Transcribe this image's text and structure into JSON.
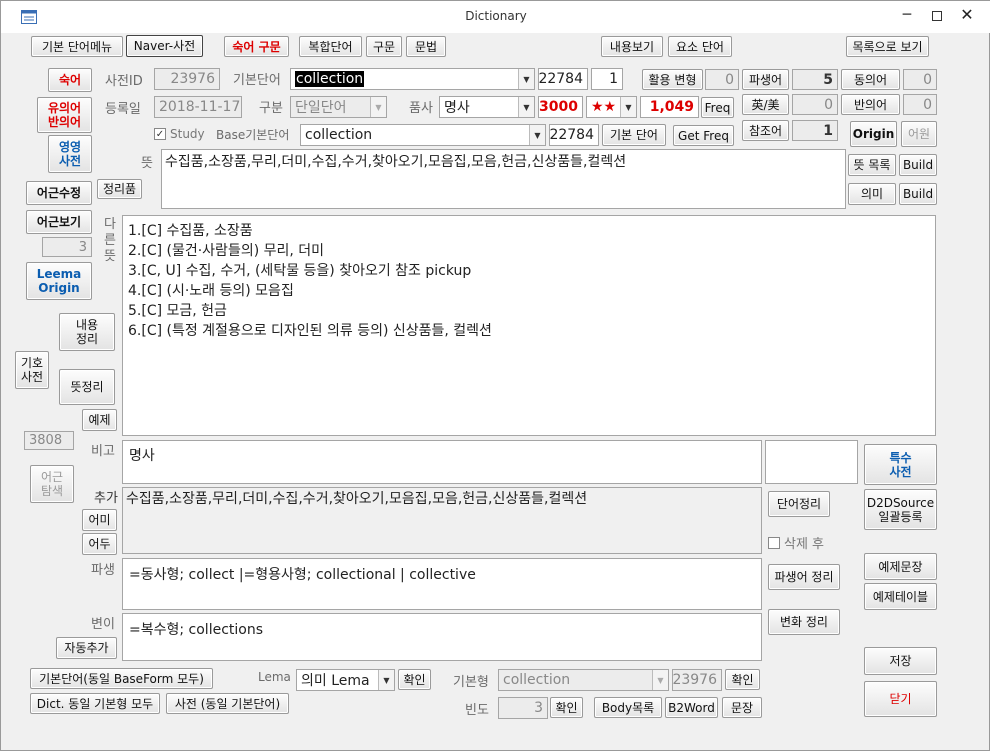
{
  "window": {
    "title": "Dictionary"
  },
  "toolbar": {
    "basic_menu": "기본 단어메뉴",
    "naver": "Naver-사전",
    "idiom": "숙어 구문",
    "compound": "복합단어",
    "phrase": "구문",
    "grammar": "문법",
    "view_content": "내용보기",
    "element_word": "요소 단어",
    "view_list": "목록으로 보기"
  },
  "left": {
    "idiom_btn": "숙어",
    "synonym_btn_1": "유의어",
    "synonym_btn_2": "반의어",
    "english_btn_1": "영영",
    "english_btn_2": "사전",
    "fix_root": "어근수정",
    "view_root": "어근보기",
    "root_count": "3",
    "leema_1": "Leema",
    "leema_2": "Origin",
    "content_1": "내용",
    "content_2": "정리",
    "symbol_1": "기호",
    "symbol_2": "사전",
    "meaning_clean": "뜻정리",
    "example": "예제",
    "count": "3808",
    "root_explore_1": "어근",
    "root_explore_2": "탐색",
    "suffix": "어미",
    "prefix": "어두",
    "auto_add": "자동추가"
  },
  "form": {
    "dict_id_label": "사전ID",
    "dict_id": "23976",
    "base_word_label": "기본단어",
    "base_word": "collection",
    "base_word_num": "22784",
    "base_word_idx": "1",
    "usage_btn": "활용 변형",
    "usage_count": "0",
    "derived_btn": "파생어",
    "derived_count": "5",
    "syn_btn": "동의어",
    "syn_count": "0",
    "reg_date_label": "등록일",
    "reg_date": "2018-11-17",
    "category_label": "구분",
    "category": "단일단어",
    "pos_label": "품사",
    "pos": "명사",
    "rank": "3000",
    "stars": "★★",
    "freq_value": "1,049",
    "freq_btn": "Freq",
    "uk_us_btn": "英/美",
    "uk_us_count": "0",
    "antonym_btn": "반의어",
    "antonym_count": "0",
    "study_label": "Study",
    "base_base_label": "Base기본단어",
    "base_base": "collection",
    "base_base_num": "22784",
    "basic_word_btn": "기본 단어",
    "get_freq_btn": "Get Freq",
    "ref_btn": "참조어",
    "ref_count": "1",
    "origin_btn": "Origin",
    "etym_btn": "어원",
    "meaning_label": "뜻",
    "meaning": "수집품,소장품,무리,더미,수집,수거,찾아오기,모음집,모음,헌금,신상품들,컬렉션",
    "meaning_list_btn": "뜻 목록",
    "build_btn": "Build",
    "sense_btn": "의미",
    "build_btn2": "Build",
    "arrange_btn": "정리품",
    "other_meaning_label": "다른뜻",
    "other_meanings": [
      "1.[C] 수집품, 소장품",
      "2.[C]  (물건·사람들의) 무리, 더미",
      "3.[C, U] 수집, 수거, (세탁물 등을) 찾아오기  참조 pickup",
      "4.[C]  (시·노래 등의) 모음집",
      "5.[C] 모금, 헌금",
      "6.[C]  (특정 계절용으로 디자인된 의류 등의) 신상품들, 컬렉션"
    ],
    "note_label": "비고",
    "note": "명사",
    "special_dict_1": "특수",
    "special_dict_2": "사전",
    "add_label": "추가",
    "add_text": "수집품,소장품,무리,더미,수집,수거,찾아오기,모음집,모음,헌금,신상품들,컬렉션",
    "word_clean_btn": "단어정리",
    "d2d_1": "D2DSource",
    "d2d_2": "일괄등록",
    "delete_after": "삭제 후",
    "derive_label": "파생",
    "derive_text": "=동사형;  collect  |=형용사형;  collectional | collective",
    "derive_clean_btn": "파생어 정리",
    "example_sentence_btn": "예제문장",
    "example_table_btn": "예제테이블",
    "variant_label": "변이",
    "variant_text": "=복수형; collections",
    "change_clean_btn": "변화 정리",
    "save_btn": "저장",
    "close_btn": "닫기"
  },
  "bottom": {
    "base_form_btn": "기본단어(동일 BaseForm  모두)",
    "lema_label": "Lema",
    "lema_value": "의미 Lema",
    "confirm1": "확인",
    "base_form_label": "기본형",
    "base_form_value": "collection",
    "base_form_num": "23976",
    "confirm2": "확인",
    "dict_same_btn": "Dict. 동일 기본형 모두",
    "dict_basic_btn": "사전 (동일 기본단어)",
    "freq_label": "빈도",
    "freq_value": "3",
    "confirm3": "확인",
    "body_list_btn": "Body목록",
    "b2word_btn": "B2Word",
    "sentence_btn": "문장"
  }
}
